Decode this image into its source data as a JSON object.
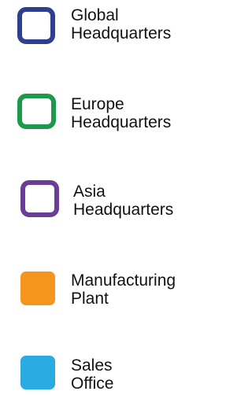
{
  "legend": {
    "items": [
      {
        "key": "global",
        "lines": [
          "Global",
          "Headquarters"
        ],
        "style": "outline",
        "color": "#2e3f92"
      },
      {
        "key": "europe",
        "lines": [
          "Europe",
          "Headquarters"
        ],
        "style": "outline",
        "color": "#1a9a4a"
      },
      {
        "key": "asia",
        "lines": [
          "Asia",
          "Headquarters"
        ],
        "style": "outline",
        "color": "#6b3d97"
      },
      {
        "key": "manufacturing",
        "lines": [
          "Manufacturing",
          "Plant"
        ],
        "style": "filled",
        "color": "#f7941d"
      },
      {
        "key": "sales",
        "lines": [
          "Sales",
          "Office"
        ],
        "style": "filled",
        "color": "#29aae1"
      }
    ]
  }
}
